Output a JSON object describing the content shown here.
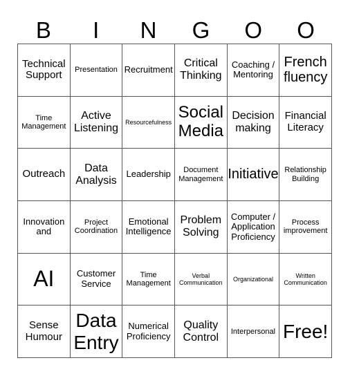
{
  "header": {
    "letters": [
      "B",
      "I",
      "N",
      "G",
      "O",
      "O"
    ]
  },
  "cells": [
    {
      "text": "Technical Support",
      "size": "s4"
    },
    {
      "text": "Presentation",
      "size": "s2"
    },
    {
      "text": "Recruitment",
      "size": "s3"
    },
    {
      "text": "Critical Thinking",
      "size": "s5"
    },
    {
      "text": "Coaching / Mentoring",
      "size": "s3"
    },
    {
      "text": "French fluency",
      "size": "s6"
    },
    {
      "text": "Time Management",
      "size": "s2"
    },
    {
      "text": "Active Listening",
      "size": "s5"
    },
    {
      "text": "Resourcefulness",
      "size": "s1"
    },
    {
      "text": "Social Media",
      "size": "s7"
    },
    {
      "text": "Decision making",
      "size": "s5"
    },
    {
      "text": "Financial Literacy",
      "size": "s4"
    },
    {
      "text": "Outreach",
      "size": "s4"
    },
    {
      "text": "Data Analysis",
      "size": "s5"
    },
    {
      "text": "Leadership",
      "size": "s3"
    },
    {
      "text": "Document Management",
      "size": "s2"
    },
    {
      "text": "Initiative",
      "size": "s6"
    },
    {
      "text": "Relationship Building",
      "size": "s2"
    },
    {
      "text": "Innovation and",
      "size": "s3"
    },
    {
      "text": "Project Coordination",
      "size": "s2"
    },
    {
      "text": "Emotional Intelligence",
      "size": "s3"
    },
    {
      "text": "Problem Solving",
      "size": "s5"
    },
    {
      "text": "Computer / Application Proficiency",
      "size": "s3"
    },
    {
      "text": "Process improvement",
      "size": "s2"
    },
    {
      "text": "AI",
      "size": "s9"
    },
    {
      "text": "Customer Service",
      "size": "s3"
    },
    {
      "text": "Time Management",
      "size": "s2"
    },
    {
      "text": "Verbal Communication",
      "size": "s1"
    },
    {
      "text": "Organizational",
      "size": "s1"
    },
    {
      "text": "Written Communication",
      "size": "s1"
    },
    {
      "text": "Sense Humour",
      "size": "s4"
    },
    {
      "text": "Data Entry",
      "size": "s8"
    },
    {
      "text": "Numerical Proficiency",
      "size": "s3"
    },
    {
      "text": "Quality Control",
      "size": "s5"
    },
    {
      "text": "Interpersonal",
      "size": "s2"
    },
    {
      "text": "Free!",
      "size": "s8"
    }
  ]
}
